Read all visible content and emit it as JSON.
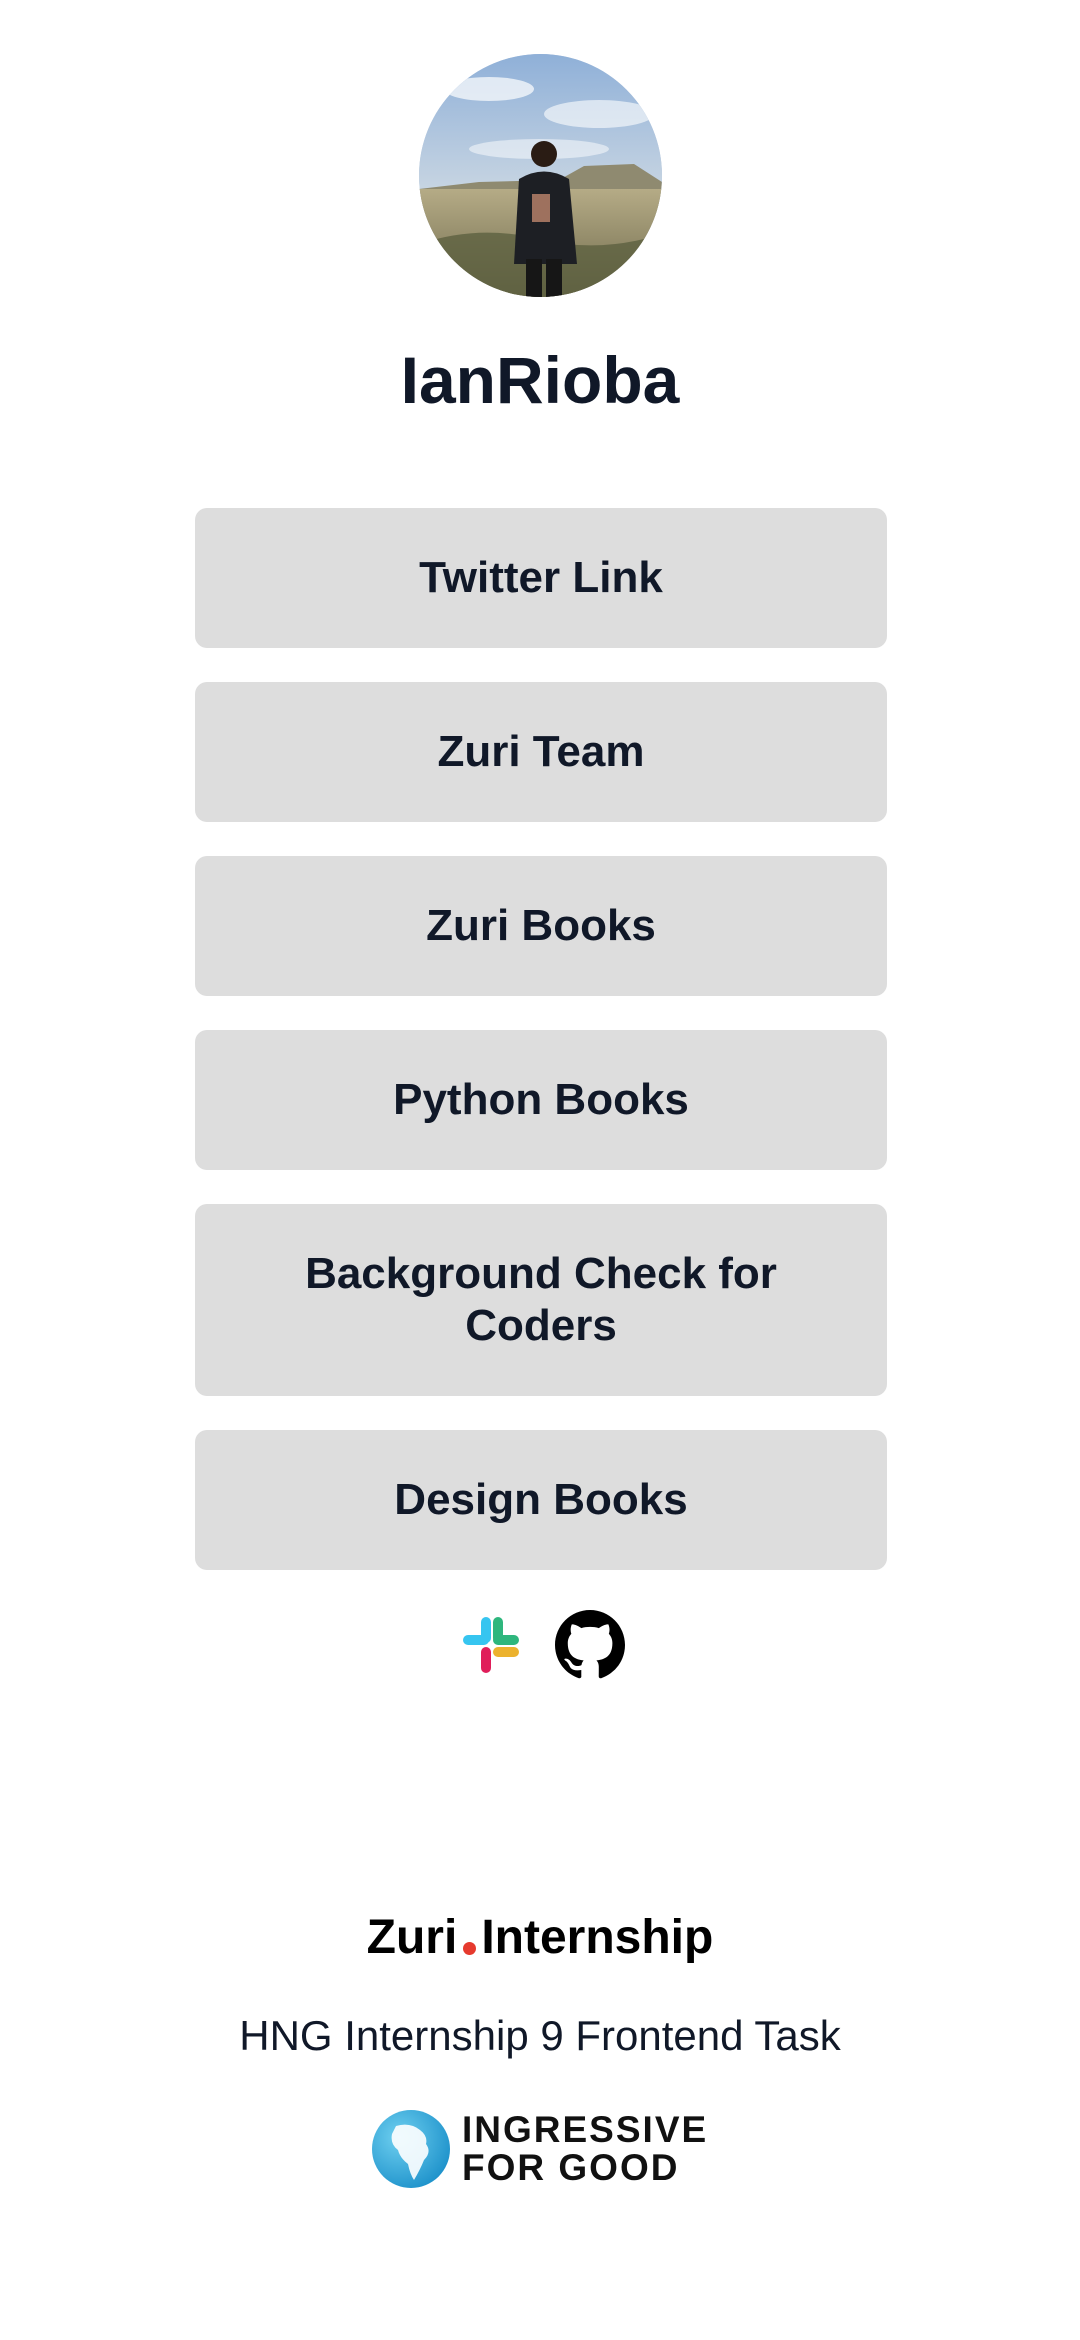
{
  "profile": {
    "username": "IanRioba",
    "avatar_icon": "profile-photo"
  },
  "links": [
    {
      "label": "Twitter Link"
    },
    {
      "label": "Zuri Team"
    },
    {
      "label": "Zuri Books"
    },
    {
      "label": "Python Books"
    },
    {
      "label": "Background Check for Coders"
    },
    {
      "label": "Design Books"
    }
  ],
  "socials": [
    {
      "icon": "slack-icon"
    },
    {
      "icon": "github-icon"
    }
  ],
  "footer": {
    "logo_left": "Zuri",
    "logo_right": "Internship",
    "logo_dot_color": "#e63a2e",
    "text": "HNG Internship 9 Frontend Task",
    "sponsor_line1": "INGRESSIVE",
    "sponsor_line2": "FOR GOOD"
  },
  "colors": {
    "button_bg": "#dddddd",
    "text": "#101828"
  }
}
